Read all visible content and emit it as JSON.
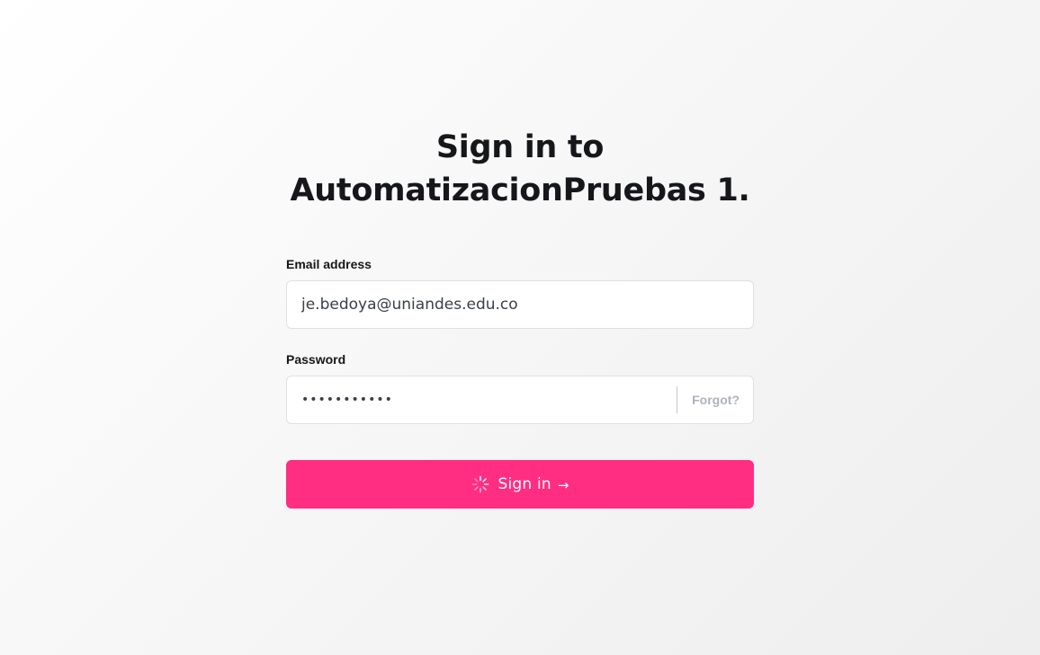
{
  "title": {
    "line1": "Sign in to",
    "line2": "AutomatizacionPruebas 1."
  },
  "form": {
    "email_label": "Email address",
    "email_value": "je.bedoya@uniandes.edu.co",
    "password_label": "Password",
    "password_value": "•••••••••••",
    "forgot_label": "Forgot?",
    "submit_label": "Sign in",
    "submit_arrow": "→",
    "submit_state": "loading"
  },
  "colors": {
    "accent": "#ff2e82",
    "text": "#15171a",
    "muted": "#adb3ba",
    "border": "#dde1e5"
  },
  "icons": {
    "spinner": "loading-spinner-icon",
    "arrow": "right-arrow-icon"
  }
}
